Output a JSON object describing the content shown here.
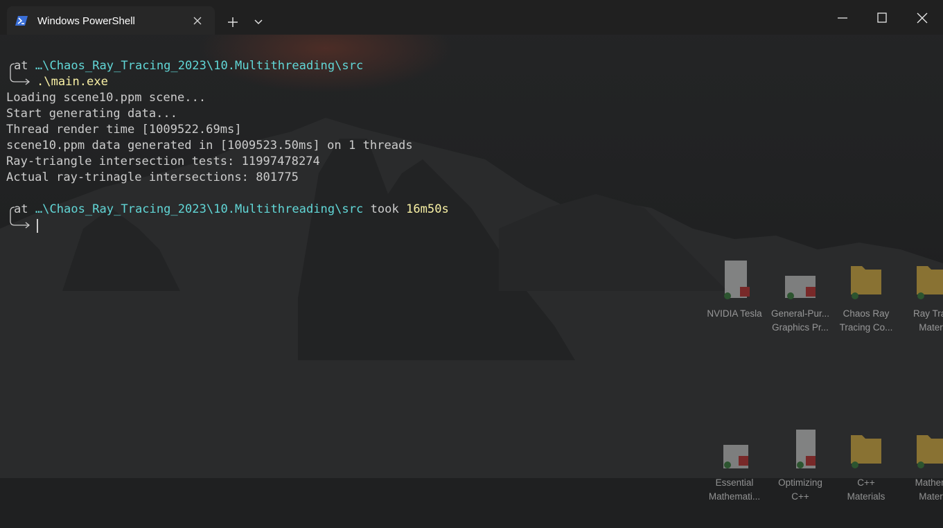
{
  "window": {
    "tab_title": "Windows PowerShell"
  },
  "terminal": {
    "prompt1": {
      "prefix": "at ",
      "path": "…\\Chaos_Ray_Tracing_2023\\10.Multithreading\\src",
      "command": ".\\main.exe"
    },
    "output": [
      "Loading scene10.ppm scene...",
      "Start generating data...",
      "Thread render time [1009522.69ms]",
      "scene10.ppm data generated in [1009523.50ms] on 1 threads",
      "Ray-triangle intersection tests: 11997478274",
      "Actual ray-trinagle intersections: 801775"
    ],
    "prompt2": {
      "prefix": "at ",
      "path": "…\\Chaos_Ray_Tracing_2023\\10.Multithreading\\src",
      "took_label": " took ",
      "duration": "16m50s"
    }
  },
  "desktop_icons": [
    {
      "line1": "NVIDIA Tesla",
      "line2": "",
      "icon": "pdf-file-icon"
    },
    {
      "line1": "General-Pur...",
      "line2": "Graphics Pr...",
      "icon": "pdf-file-icon"
    },
    {
      "line1": "Chaos Ray",
      "line2": "Tracing Co...",
      "icon": "folder-icon"
    },
    {
      "line1": "Ray Trac",
      "line2": "Materi",
      "icon": "folder-icon"
    },
    {
      "line1": "Essential",
      "line2": "Mathemati...",
      "icon": "pdf-file-icon"
    },
    {
      "line1": "Optimizing",
      "line2": "C++",
      "icon": "pdf-file-icon"
    },
    {
      "line1": "C++",
      "line2": "Materials",
      "icon": "folder-icon"
    },
    {
      "line1": "Mathem",
      "line2": "Materi",
      "icon": "folder-icon"
    }
  ],
  "colors": {
    "path": "#61d6d6",
    "command": "#f9f1a5",
    "text": "#cccccc"
  }
}
